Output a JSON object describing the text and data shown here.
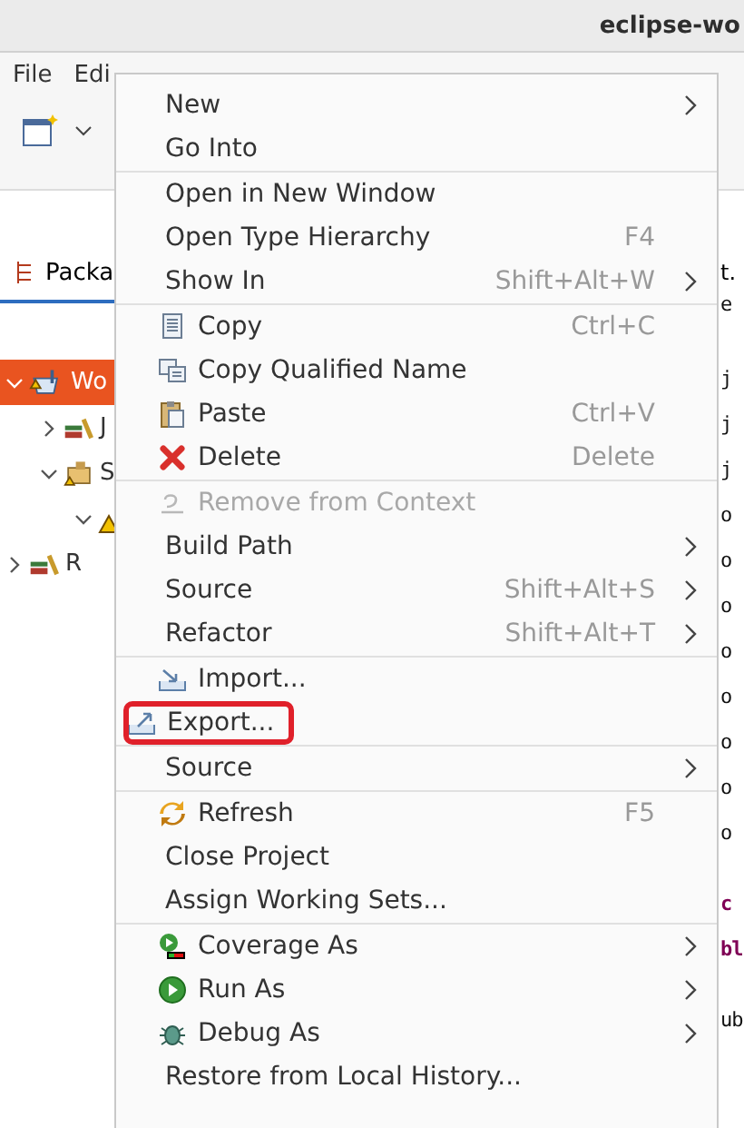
{
  "window": {
    "title": "eclipse-wo"
  },
  "menubar": [
    {
      "label": "File"
    },
    {
      "label": "Edi"
    }
  ],
  "explorer": {
    "tab": "Packa",
    "tree": [
      {
        "label": "Wo",
        "kind": "project",
        "selected": true,
        "expanded": true,
        "children": [
          {
            "label": "J",
            "kind": "library",
            "selected": false,
            "expanded": false
          },
          {
            "label": "S",
            "kind": "folder",
            "selected": false,
            "expanded": true,
            "children": [
              {
                "kind": "package",
                "selected": false,
                "expanded": true
              }
            ]
          }
        ]
      },
      {
        "label": "R",
        "kind": "library",
        "selected": false,
        "expanded": false
      }
    ]
  },
  "editor": {
    "tab": "t.",
    "blocks": [
      [
        "e"
      ],
      [
        "j",
        "j",
        "j",
        "o",
        "o",
        "o",
        "o",
        "o",
        "o",
        "o",
        "o"
      ],
      [
        "c",
        "bl"
      ],
      [
        "ub"
      ]
    ]
  },
  "context_menu": [
    {
      "kind": "item",
      "label": "New",
      "submenu": true
    },
    {
      "kind": "item",
      "label": "Go Into"
    },
    {
      "kind": "separator"
    },
    {
      "kind": "item",
      "label": "Open in New Window"
    },
    {
      "kind": "item",
      "label": "Open Type Hierarchy",
      "shortcut": "F4"
    },
    {
      "kind": "item",
      "label": "Show In",
      "shortcut": "Shift+Alt+W",
      "submenu": true
    },
    {
      "kind": "separator"
    },
    {
      "kind": "copy",
      "label": "Copy",
      "shortcut": "Ctrl+C"
    },
    {
      "kind": "copyname",
      "label": "Copy Qualified Name"
    },
    {
      "kind": "paste",
      "label": "Paste",
      "shortcut": "Ctrl+V"
    },
    {
      "kind": "delete",
      "label": "Delete",
      "shortcut": "Delete"
    },
    {
      "kind": "separator"
    },
    {
      "kind": "remove",
      "label": "Remove from Context",
      "disabled": true
    },
    {
      "kind": "item",
      "label": "Build Path",
      "submenu": true
    },
    {
      "kind": "item",
      "label": "Source",
      "shortcut": "Shift+Alt+S",
      "submenu": true
    },
    {
      "kind": "item",
      "label": "Refactor",
      "shortcut": "Shift+Alt+T",
      "submenu": true
    },
    {
      "kind": "separator"
    },
    {
      "kind": "import",
      "label": "Import..."
    },
    {
      "kind": "export",
      "label": "Export...",
      "highlighted": true
    },
    {
      "kind": "separator"
    },
    {
      "kind": "item",
      "label": "Source",
      "submenu": true
    },
    {
      "kind": "separator"
    },
    {
      "kind": "refresh",
      "label": "Refresh",
      "shortcut": "F5"
    },
    {
      "kind": "item",
      "label": "Close Project"
    },
    {
      "kind": "item",
      "label": "Assign Working Sets..."
    },
    {
      "kind": "separator"
    },
    {
      "kind": "coverage",
      "label": "Coverage As",
      "submenu": true
    },
    {
      "kind": "run",
      "label": "Run As",
      "submenu": true
    },
    {
      "kind": "debug",
      "label": "Debug As",
      "submenu": true
    },
    {
      "kind": "item",
      "label": "Restore from Local History..."
    }
  ]
}
